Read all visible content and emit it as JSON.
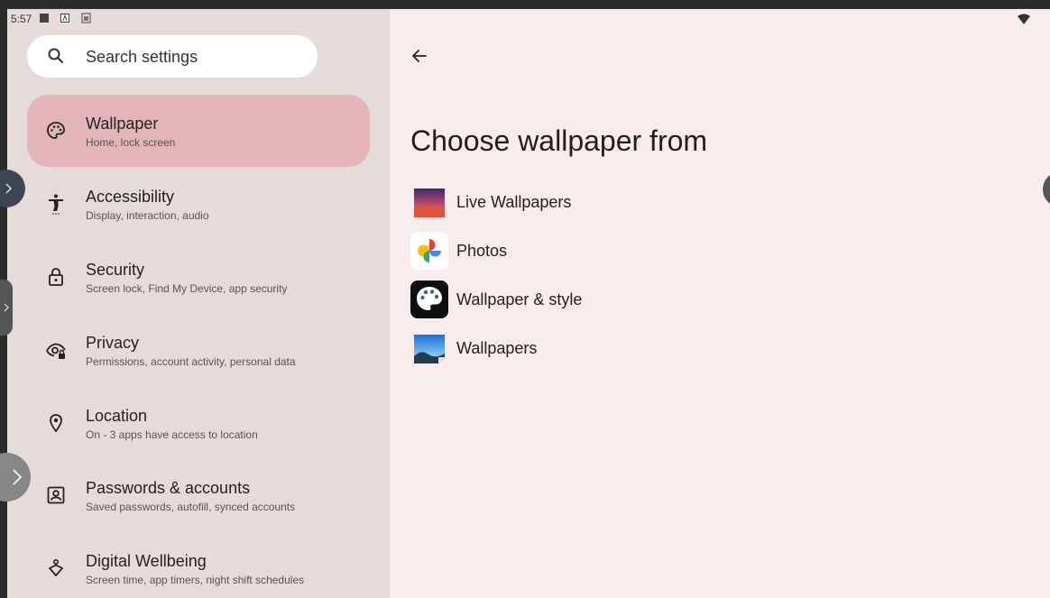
{
  "status_bar": {
    "time": "5:57"
  },
  "search": {
    "placeholder": "Search settings"
  },
  "settings_items": [
    {
      "title": "Wallpaper",
      "subtitle": "Home, lock screen",
      "icon": "palette-icon",
      "active": true
    },
    {
      "title": "Accessibility",
      "subtitle": "Display, interaction, audio",
      "icon": "accessibility-icon",
      "active": false
    },
    {
      "title": "Security",
      "subtitle": "Screen lock, Find My Device, app security",
      "icon": "lock-icon",
      "active": false
    },
    {
      "title": "Privacy",
      "subtitle": "Permissions, account activity, personal data",
      "icon": "privacy-eye-icon",
      "active": false
    },
    {
      "title": "Location",
      "subtitle": "On - 3 apps have access to location",
      "icon": "location-pin-icon",
      "active": false
    },
    {
      "title": "Passwords & accounts",
      "subtitle": "Saved passwords, autofill, synced accounts",
      "icon": "account-box-icon",
      "active": false
    },
    {
      "title": "Digital Wellbeing",
      "subtitle": "Screen time, app timers, night shift schedules",
      "icon": "wellbeing-icon",
      "active": false
    }
  ],
  "detail": {
    "heading": "Choose wallpaper from",
    "apps": [
      {
        "label": "Live Wallpapers",
        "icon": "live-wallpapers-icon"
      },
      {
        "label": "Photos",
        "icon": "photos-icon"
      },
      {
        "label": "Wallpaper & style",
        "icon": "wallpaper-style-icon"
      },
      {
        "label": "Wallpapers",
        "icon": "wallpapers-icon"
      }
    ]
  },
  "colors": {
    "left_pane": "#e5dbd9",
    "right_pane": "#f8ecec",
    "active_item": "#e3b5bb",
    "search_bg": "#ffffff"
  }
}
